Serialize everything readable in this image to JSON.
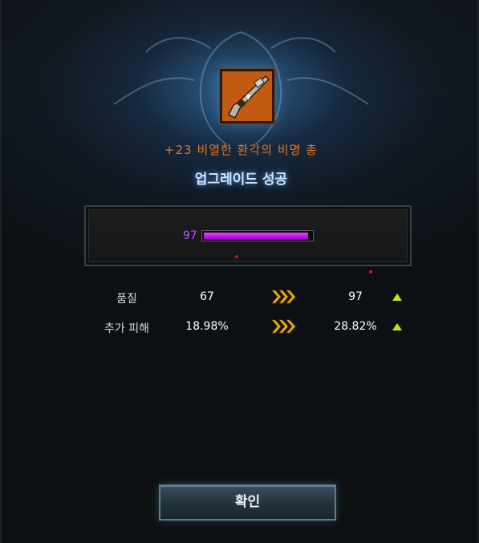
{
  "item": {
    "name": "+23 비열한 환각의 비명 총",
    "icon": "gun-icon"
  },
  "result": {
    "title": "업그레이드 성공"
  },
  "gauge": {
    "value": "97",
    "fill_fraction": 0.97
  },
  "stats": [
    {
      "label": "품질",
      "before": "67",
      "after": "97"
    },
    {
      "label": "추가 피해",
      "before": "18.98%",
      "after": "28.82%"
    }
  ],
  "confirm_label": "확인",
  "colors": {
    "item_name": "#e2761f",
    "gauge_fill": "#c020f0",
    "arrow": "#f5b800",
    "increase": "#b8f000"
  }
}
